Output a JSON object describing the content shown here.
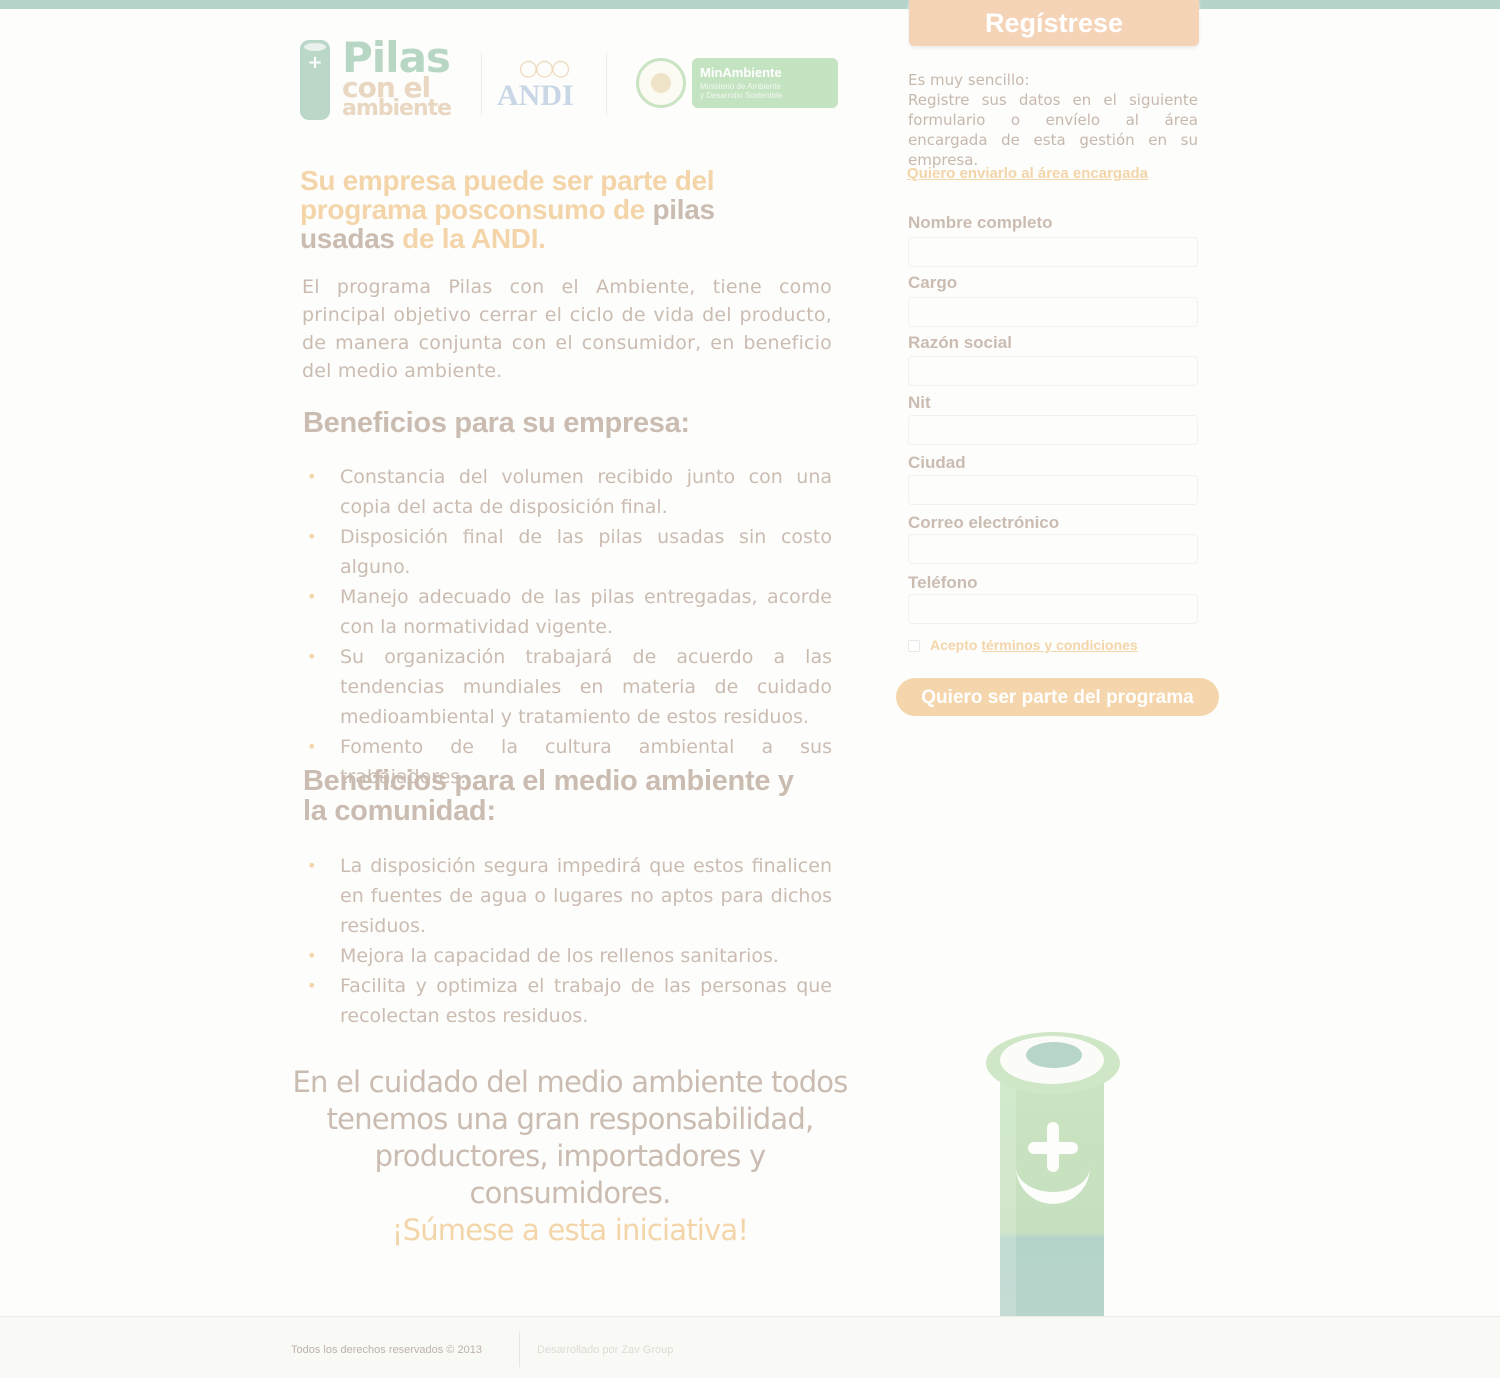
{
  "logos": {
    "pilas": {
      "line1": "Pilas",
      "line2": "con el",
      "line3": "ambiente"
    },
    "andi": {
      "text": "ANDI"
    },
    "minambiente": {
      "title": "MinAmbiente",
      "sub1": "Ministerio de Ambiente",
      "sub2": "y Desarrollo Sostenible"
    }
  },
  "main": {
    "headline": {
      "part1": "Su empresa puede ser parte del programa posconsumo de ",
      "part2": "pilas usadas",
      "part3": " de la ANDI."
    },
    "intro": "El programa Pilas con el Ambiente, tiene como principal objetivo cerrar el ciclo de vida del producto, de manera conjunta con el consumidor, en beneficio del medio ambiente.",
    "company_benefits": {
      "title": "Beneficios para su empresa:",
      "items": [
        "Constancia del volumen recibido junto con una copia del acta de disposición final.",
        "Disposición final de las pilas usadas sin costo alguno.",
        "Manejo adecuado de las pilas entregadas, acorde con la normatividad vigente.",
        "Su organización trabajará de acuerdo a las tendencias mundiales en materia de cuidado medioambiental y tratamiento de estos residuos.",
        "Fomento de la cultura ambiental a sus trabajadores."
      ]
    },
    "env_benefits": {
      "title": "Beneficios para el medio ambiente y la comunidad:",
      "items": [
        "La disposición segura impedirá que estos finalicen en fuentes de agua o lugares no aptos para dichos residuos.",
        "Mejora la capacidad de los rellenos sanitarios.",
        "Facilita y optimiza el trabajo de las personas que recolectan estos residuos."
      ]
    },
    "closing": {
      "text": "En el cuidado del medio ambiente todos tenemos una gran responsabilidad, productores, importadores y consumidores.",
      "cta": "¡Súmese a esta iniciativa!"
    }
  },
  "sidebar": {
    "tab_label": "Regístrese",
    "desc_line1": "Es muy sencillo:",
    "desc_rest": "Registre sus datos en el siguiente formulario o envíelo al área encargada de esta gestión en su empresa.",
    "send_link": "Quiero enviarlo al área encargada",
    "fields": {
      "nombre": "Nombre completo",
      "cargo": "Cargo",
      "razon": "Razón social",
      "nit": "Nit",
      "ciudad": "Ciudad",
      "correo": "Correo electrónico",
      "telefono": "Teléfono"
    },
    "terms_prefix": "Acepto ",
    "terms_link": "términos y condiciones",
    "submit": "Quiero ser parte del programa"
  },
  "footer": {
    "rights": "Todos los derechos reservados © 2013",
    "developer": "Desarrollado por Zav Group"
  },
  "colors": {
    "accent_orange": "#f3d5a9",
    "text_taupe": "#cbbcb2",
    "brand_green": "#c4e3c1",
    "battery_teal": "#b8d5c9"
  },
  "icons": [
    "battery-logo-icon",
    "andi-rings-icon",
    "colombia-seal-icon",
    "bullet-dot-icon",
    "battery-illustration"
  ]
}
